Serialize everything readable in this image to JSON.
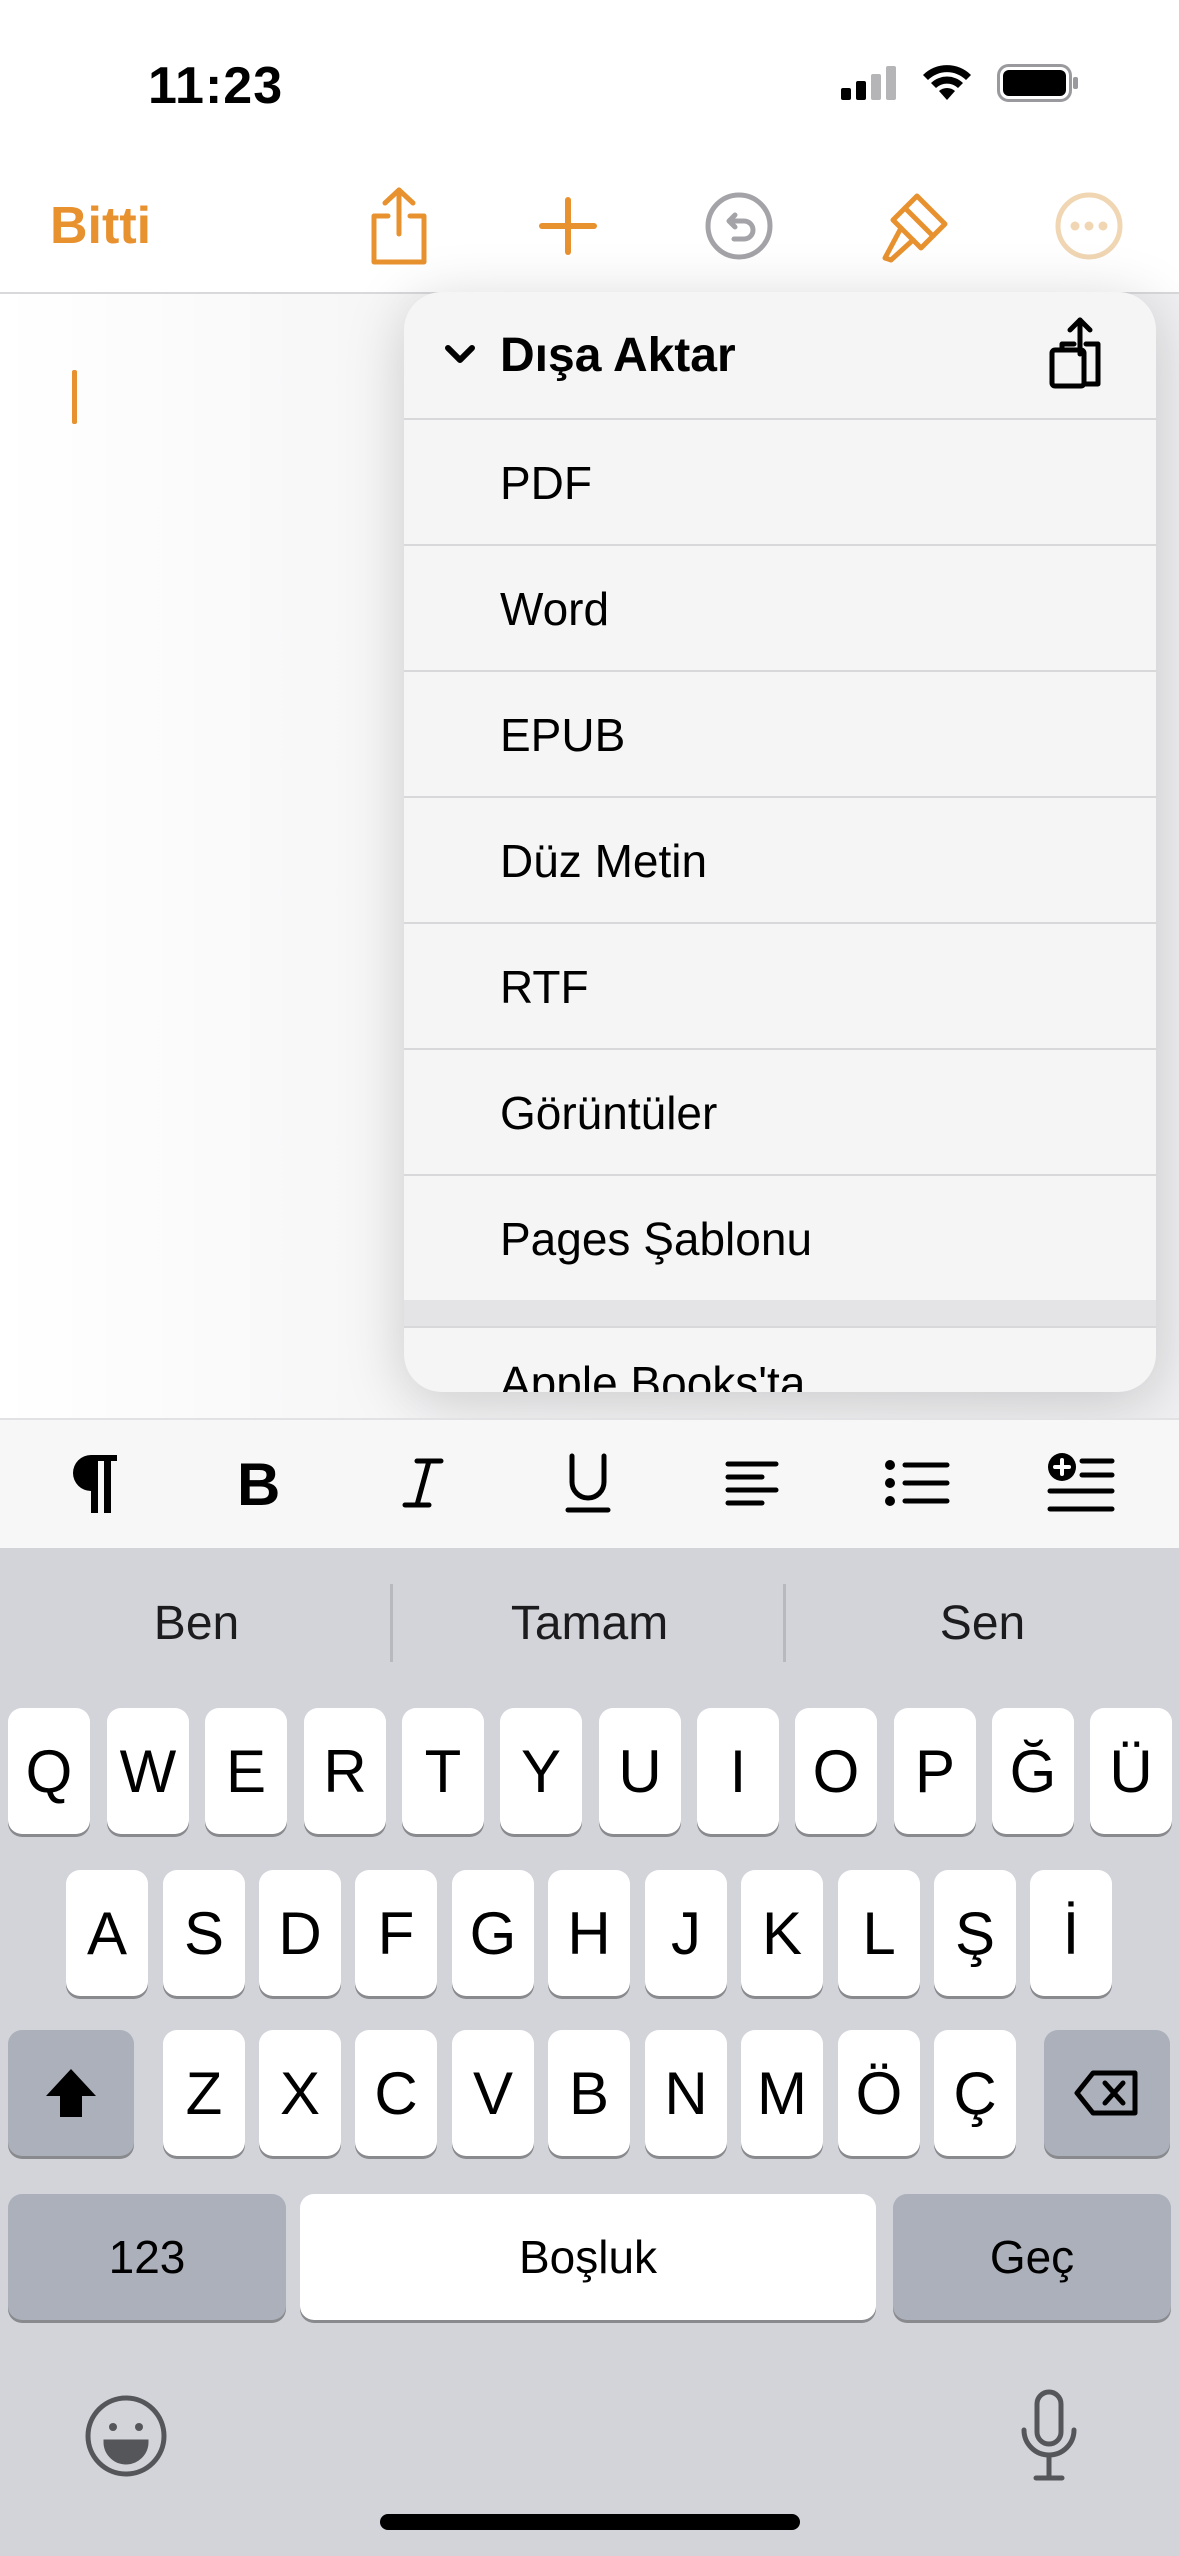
{
  "status": {
    "time": "11:23"
  },
  "toolbar": {
    "done_label": "Bitti",
    "accent_color": "#e8912f",
    "icons": [
      "share-icon",
      "plus-icon",
      "undo-icon",
      "paintbrush-icon",
      "more-icon"
    ]
  },
  "menu": {
    "title": "Dışa Aktar",
    "items": [
      "PDF",
      "Word",
      "EPUB",
      "Düz Metin",
      "RTF",
      "Görüntüler",
      "Pages Şablonu"
    ],
    "secondary_item": "Apple Books'ta"
  },
  "format_bar": {
    "icons": [
      "paragraph-style-icon",
      "bold-icon",
      "italic-icon",
      "underline-icon",
      "align-left-icon",
      "bullet-list-icon",
      "insert-icon"
    ]
  },
  "keyboard": {
    "suggestions": [
      "Ben",
      "Tamam",
      "Sen"
    ],
    "row1": [
      "Q",
      "W",
      "E",
      "R",
      "T",
      "Y",
      "U",
      "I",
      "O",
      "P",
      "Ğ",
      "Ü"
    ],
    "row2": [
      "A",
      "S",
      "D",
      "F",
      "G",
      "H",
      "J",
      "K",
      "L",
      "Ş",
      "İ"
    ],
    "row3": [
      "Z",
      "X",
      "C",
      "V",
      "B",
      "N",
      "M",
      "Ö",
      "Ç"
    ],
    "numbers_label": "123",
    "space_label": "Boşluk",
    "return_label": "Geç"
  }
}
